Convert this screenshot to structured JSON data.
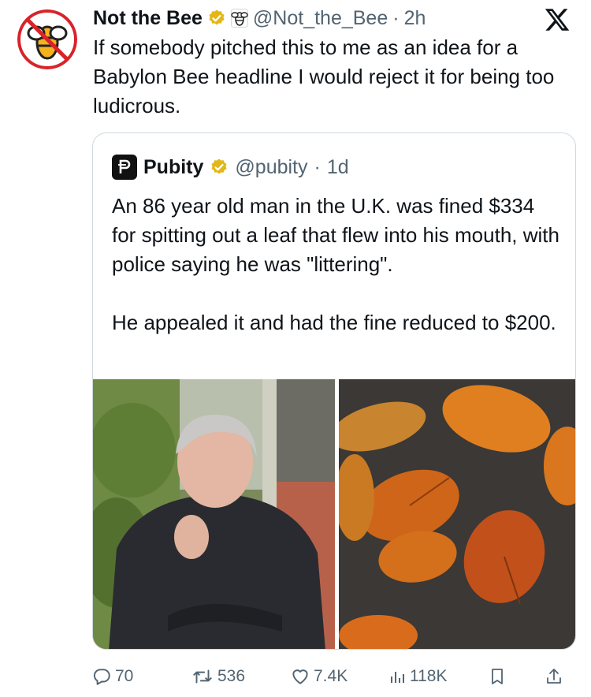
{
  "tweet": {
    "author_name": "Not the Bee",
    "handle": "@Not_the_Bee",
    "separator": "·",
    "time": "2h",
    "text": "If somebody pitched this to me as an idea for a Babylon Bee headline I would reject it for being too ludicrous.",
    "verified_badge_color": "#e2b719"
  },
  "quote": {
    "author_name": "Pubity",
    "handle": "@pubity",
    "separator": "·",
    "time": "1d",
    "avatar_letter": "P",
    "paragraphs": [
      "An 86 year old man in the U.K. was fined $334 for spitting out a leaf that flew into his mouth, with police saying he was \"littering\".",
      "He appealed it and had the fine reduced to $200."
    ]
  },
  "actions": {
    "replies": "70",
    "reposts": "536",
    "likes": "7.4K",
    "views": "118K"
  },
  "colors": {
    "text": "#0f1419",
    "muted": "#536471",
    "border": "#cfd9de",
    "leaf": "#d9761e",
    "soil": "#3b3836"
  }
}
